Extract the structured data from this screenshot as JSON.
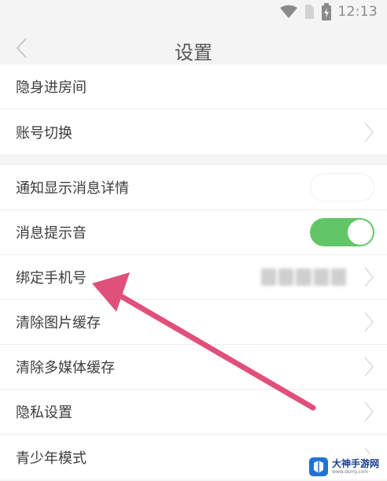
{
  "status_bar": {
    "time": "12:13",
    "icons": [
      "wifi-icon",
      "sim-icon",
      "battery-charging-icon"
    ]
  },
  "nav": {
    "title": "设置",
    "back_icon": "chevron-left-icon"
  },
  "group1": {
    "items": [
      {
        "label": "隐身进房间",
        "control": "none"
      },
      {
        "label": "账号切换",
        "control": "chevron"
      }
    ]
  },
  "group2": {
    "items": [
      {
        "label": "通知显示消息详情",
        "control": "toggle",
        "on": false
      },
      {
        "label": "消息提示音",
        "control": "toggle",
        "on": true
      },
      {
        "label": "绑定手机号",
        "control": "chevron",
        "value_obscured": true
      },
      {
        "label": "清除图片缓存",
        "control": "chevron"
      },
      {
        "label": "清除多媒体缓存",
        "control": "chevron"
      },
      {
        "label": "隐私设置",
        "control": "chevron"
      },
      {
        "label": "青少年模式",
        "control": "chevron"
      }
    ]
  },
  "colors": {
    "toggle_on": "#62c668",
    "annotation_arrow": "#e0507a",
    "background": "#f4f4f4"
  },
  "watermark": {
    "title": "大神手游网",
    "subtitle": "www.dsmy.com"
  }
}
